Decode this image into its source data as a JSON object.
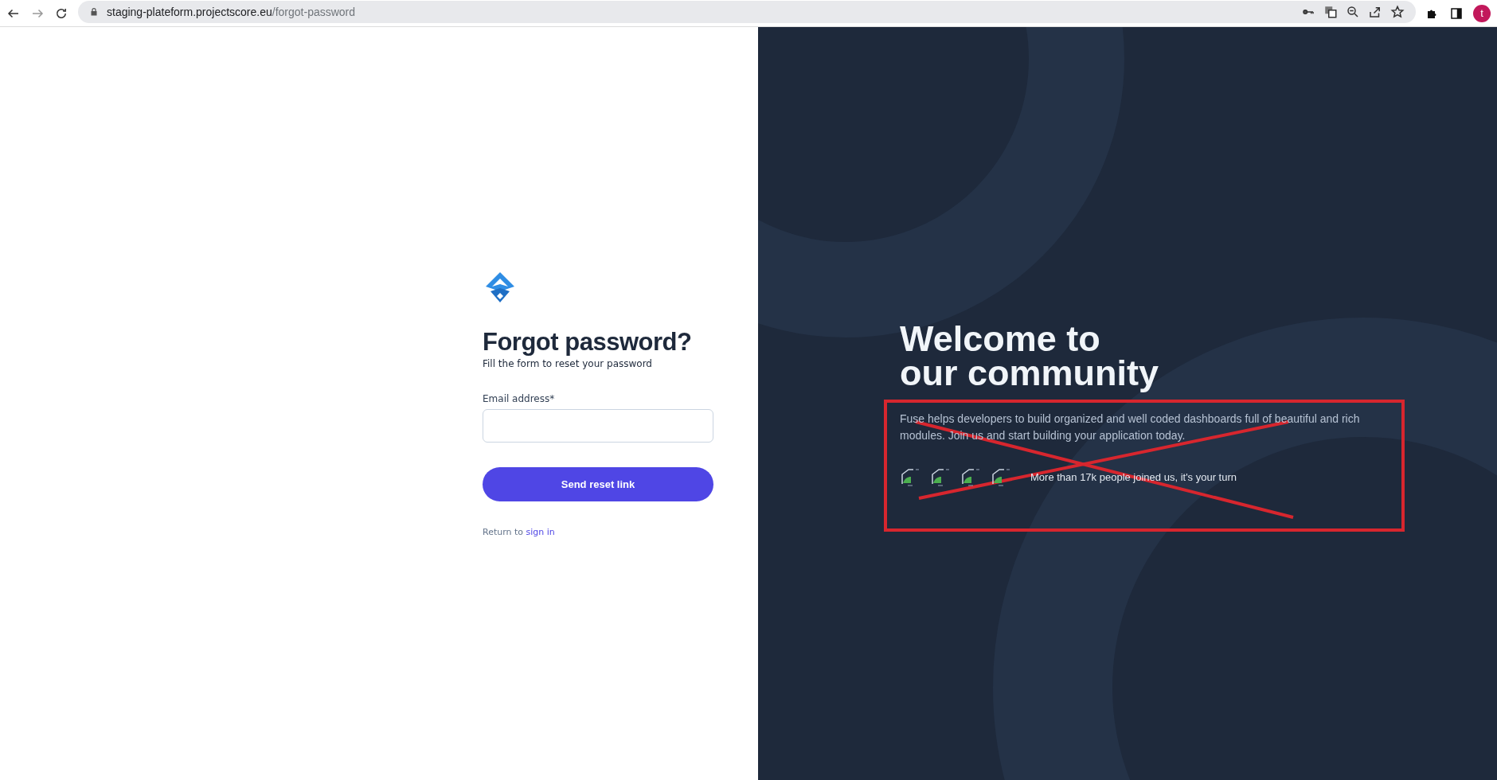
{
  "browser": {
    "url_host": "staging-plateform.projectscore.eu",
    "url_path": "/forgot-password",
    "profile_initial": "t"
  },
  "form": {
    "title": "Forgot password?",
    "subtitle": "Fill the form to reset your password",
    "email_label": "Email address",
    "required_mark": "*",
    "submit": "Send reset link",
    "return_text": "Return to",
    "return_link": "sign in"
  },
  "promo": {
    "heading_lines": [
      "Welcome to",
      "our community"
    ],
    "text": "Fuse helps developers to build organized and well coded dashboards full of beautiful and rich modules. Join us and start building your application today.",
    "members_text": "More than 17k people joined us, it's your turn"
  }
}
